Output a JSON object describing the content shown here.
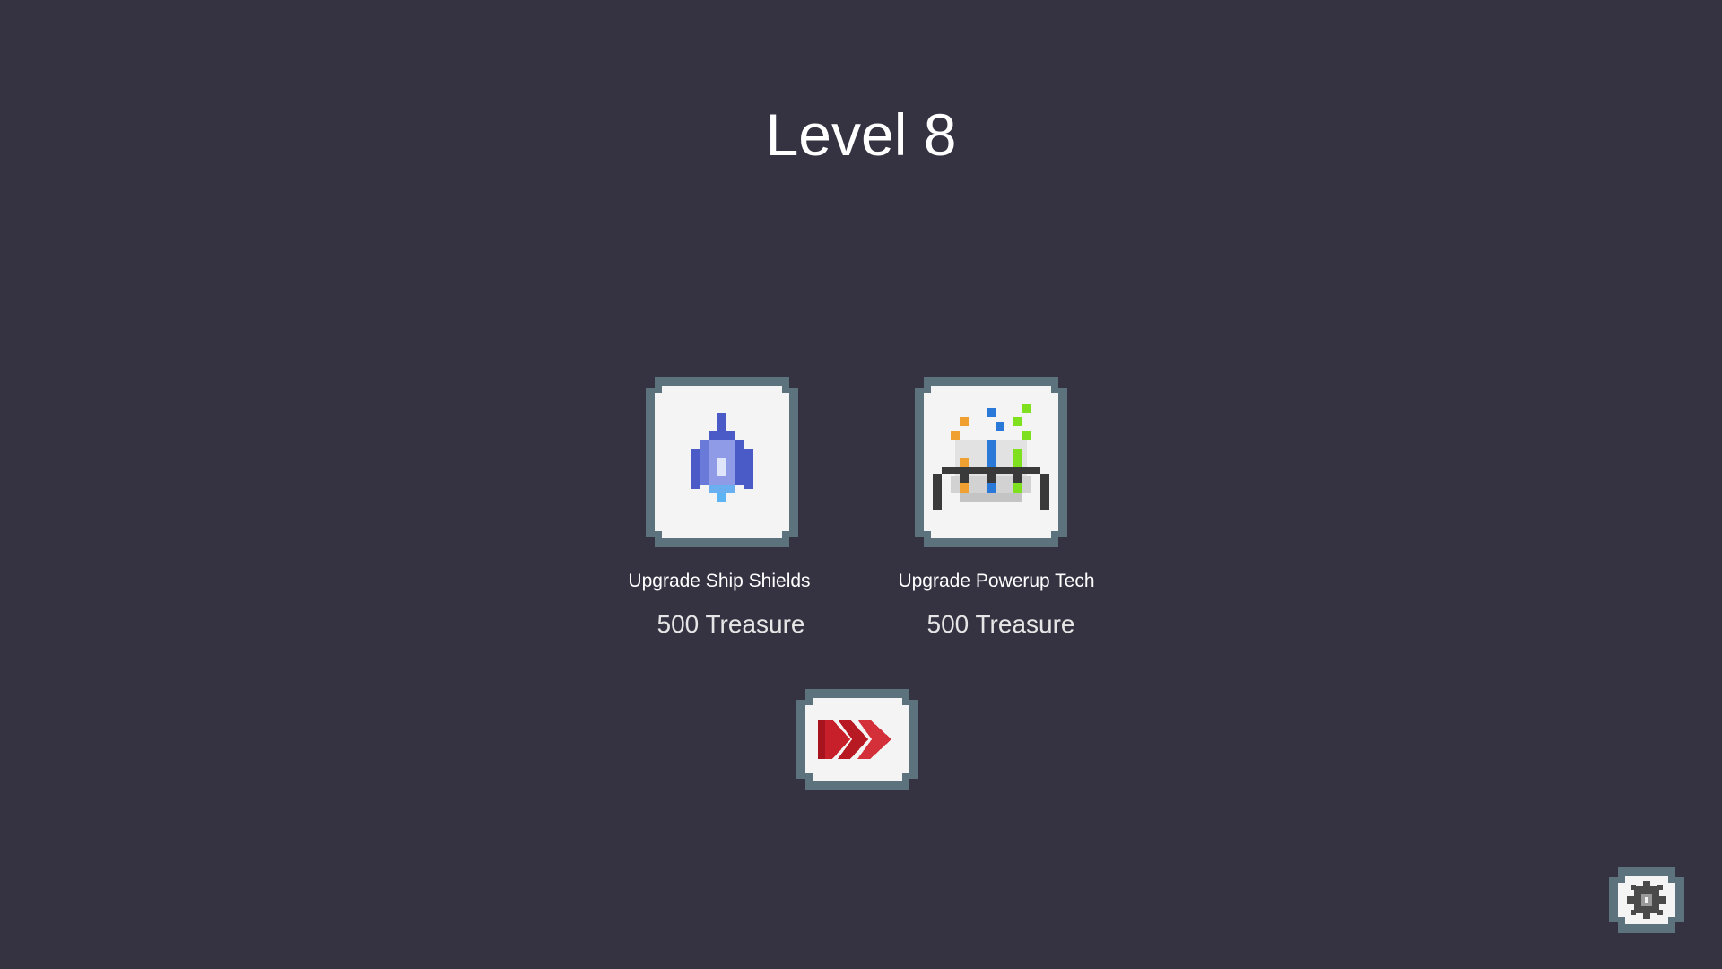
{
  "title": "Level 8",
  "upgrades": [
    {
      "name": "Upgrade Ship Shields",
      "price": "500 Treasure",
      "icon": "ship-shield-icon"
    },
    {
      "name": "Upgrade Powerup Tech",
      "price": "500 Treasure",
      "icon": "powerup-tech-icon"
    }
  ],
  "continue_button": {
    "icon": "fast-forward-icon"
  },
  "settings_button": {
    "icon": "gear-icon"
  },
  "colors": {
    "background": "#353242",
    "tile_border": "#5c727d",
    "tile_face": "#f4f4f4",
    "forward_red": "#c8202a"
  }
}
